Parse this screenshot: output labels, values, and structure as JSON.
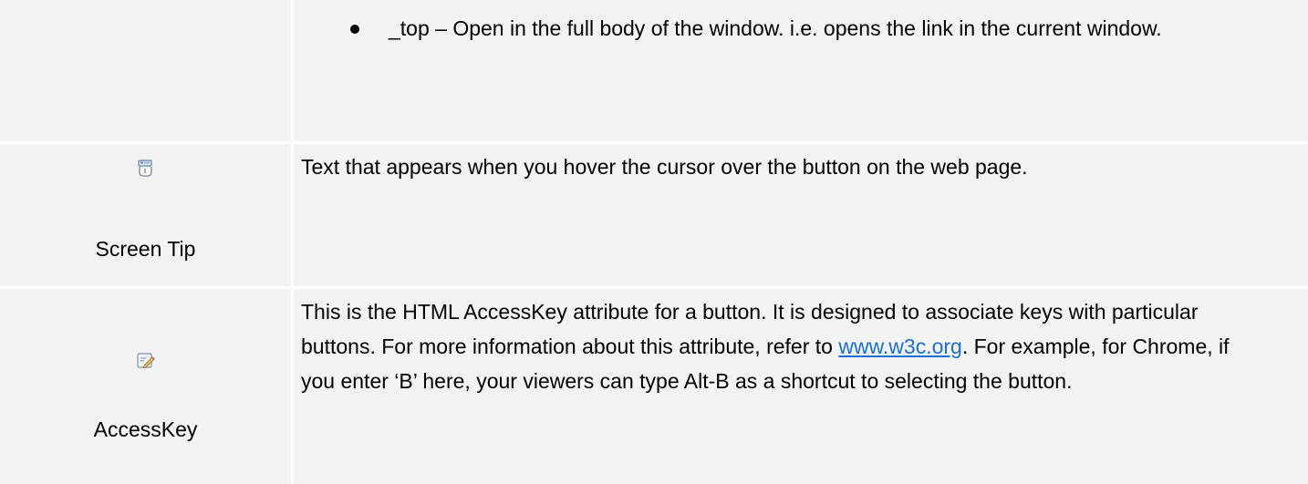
{
  "row_target": {
    "bullet_text": "_top – Open in the full body of the window.  i.e. opens the link in the current window."
  },
  "row_screen_tip": {
    "icon": "screen-tip-icon",
    "label": "Screen Tip",
    "description": "Text that appears when you hover the cursor over the button on the web page."
  },
  "row_accesskey": {
    "icon": "edit-pencil-icon",
    "label": "AccessKey",
    "description_before": "This is the HTML AccessKey attribute for a button.  It is designed to associate keys with particular buttons.  For more information about this attribute, refer to ",
    "link_text": "www.w3c.org",
    "description_after": ".  For example, for Chrome, if you enter ‘B’ here, your viewers can type Alt-B as a shortcut to selecting the button."
  }
}
